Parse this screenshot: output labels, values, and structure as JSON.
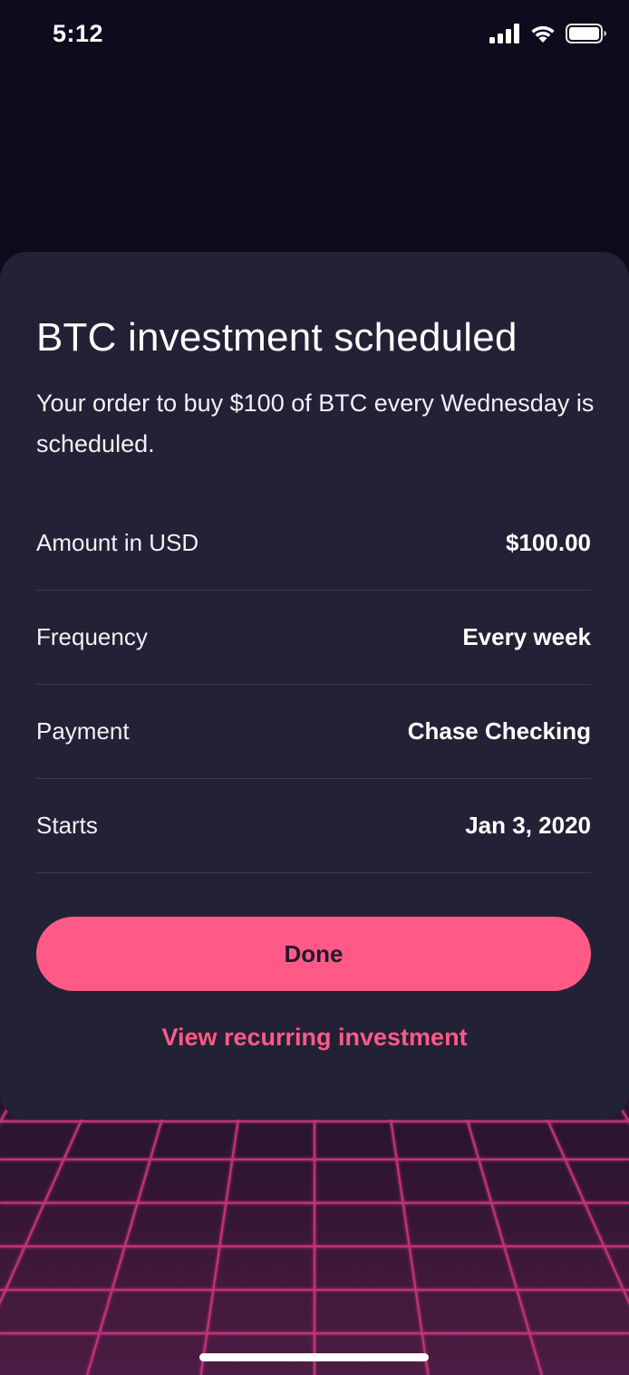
{
  "status_bar": {
    "time": "5:12",
    "icons": [
      "cellular-signal-icon",
      "wifi-icon",
      "battery-icon"
    ]
  },
  "card": {
    "title": "BTC investment scheduled",
    "subtitle": "Your order to buy $100 of BTC every Wednesday is scheduled.",
    "details": [
      {
        "label": "Amount in USD",
        "value": "$100.00"
      },
      {
        "label": "Frequency",
        "value": "Every week"
      },
      {
        "label": "Payment",
        "value": "Chase Checking"
      },
      {
        "label": "Starts",
        "value": "Jan 3, 2020"
      }
    ],
    "done_label": "Done",
    "view_link_label": "View recurring investment"
  },
  "colors": {
    "background": "#0e0b1d",
    "card": "#232135",
    "accent": "#ff5a87",
    "grid_line": "#c2307a",
    "divider": "#3c3a4f"
  }
}
